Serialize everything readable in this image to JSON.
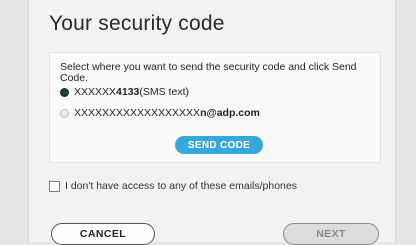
{
  "title": "Your security code",
  "instructions": "Select where you want to send the security code and click Send Code.",
  "options": [
    {
      "masked": "XXXXXX",
      "suffix": "4133",
      "detail": " (SMS text)",
      "selected": true
    },
    {
      "masked": "XXXXXXXXXXXXXXXXXX",
      "suffix": "n@adp.com",
      "detail": "",
      "selected": false
    }
  ],
  "send_button": "SEND CODE",
  "no_access_label": "I don't have access to any of these emails/phones",
  "cancel_button": "CANCEL",
  "next_button": "NEXT",
  "colors": {
    "send_button": "#3aa7dc",
    "selected_radio": "#1e3a45",
    "background": "#e6e6e6",
    "panel": "#f2f2f2"
  }
}
